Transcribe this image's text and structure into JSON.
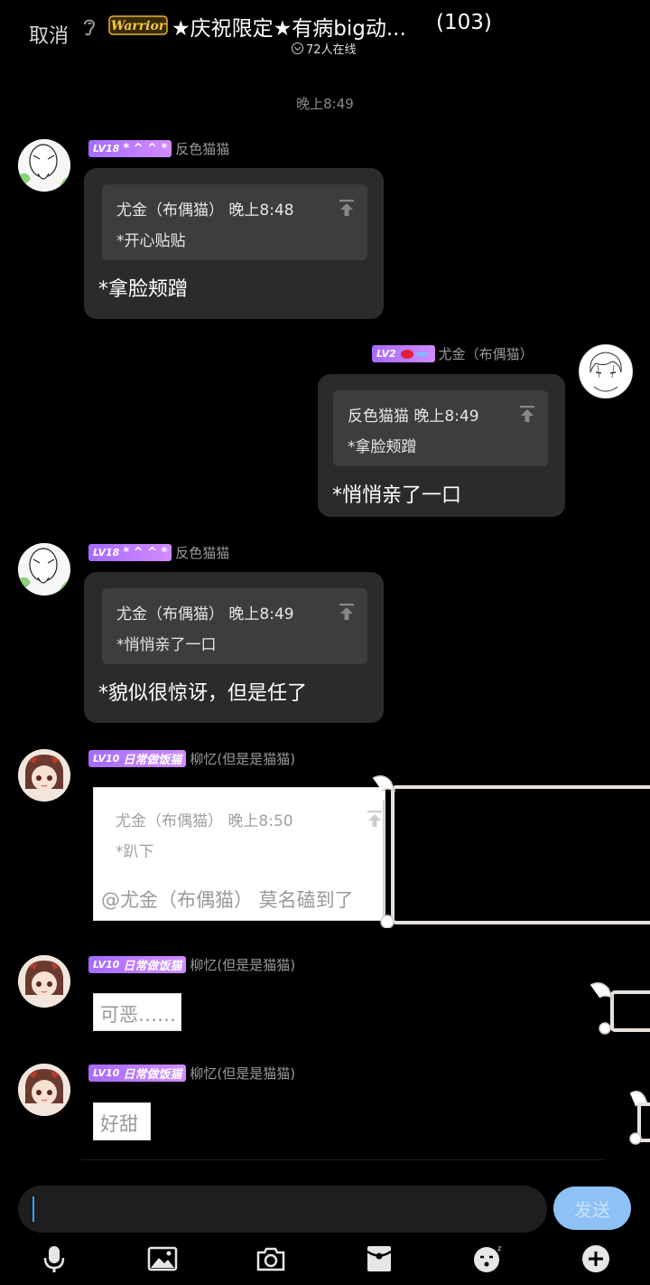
{
  "header": {
    "cancel_label": "取消",
    "group_title": "★庆祝限定★有病big动...",
    "member_count": "(103)",
    "online_text": "72人在线"
  },
  "timestamp": "晚上8:49",
  "messages": [
    {
      "sender": "反色猫猫",
      "level": "LV18",
      "title": "* ^ ^ *",
      "quote_header": "尤金（布偶猫） 晚上8:48",
      "quote_text": "*开心贴贴",
      "text": "*拿脸颊蹭"
    },
    {
      "sender": "尤金（布偶猫）",
      "level": "LV2",
      "quote_header": "反色猫猫 晚上8:49",
      "quote_text": "*拿脸颊蹭",
      "text": "*悄悄亲了一口"
    },
    {
      "sender": "反色猫猫",
      "level": "LV18",
      "title": "* ^ ^ *",
      "quote_header": "尤金（布偶猫） 晚上8:49",
      "quote_text": "*悄悄亲了一口",
      "text": "*貌似很惊讶，但是任了"
    },
    {
      "sender": "柳忆(但是是猫猫)",
      "level": "LV10",
      "title": "日常做饭猫",
      "quote_header": "尤金（布偶猫） 晚上8:50",
      "quote_text": "*趴下",
      "text": "@尤金（布偶猫） 莫名磕到了"
    },
    {
      "sender": "柳忆(但是是猫猫)",
      "level": "LV10",
      "title": "日常做饭猫",
      "text": "可恶……"
    },
    {
      "sender": "柳忆(但是是猫猫)",
      "level": "LV10",
      "title": "日常做饭猫",
      "text": "好甜"
    }
  ],
  "composer": {
    "send_label": "发送"
  },
  "toolbar": [
    "mic-icon",
    "image-icon",
    "camera-icon",
    "redpacket-icon",
    "emoji-icon",
    "plus-icon"
  ],
  "colors": {
    "accent": "#8ec1f5",
    "badge": "#b477ff",
    "bubble": "#2b2b2b"
  }
}
